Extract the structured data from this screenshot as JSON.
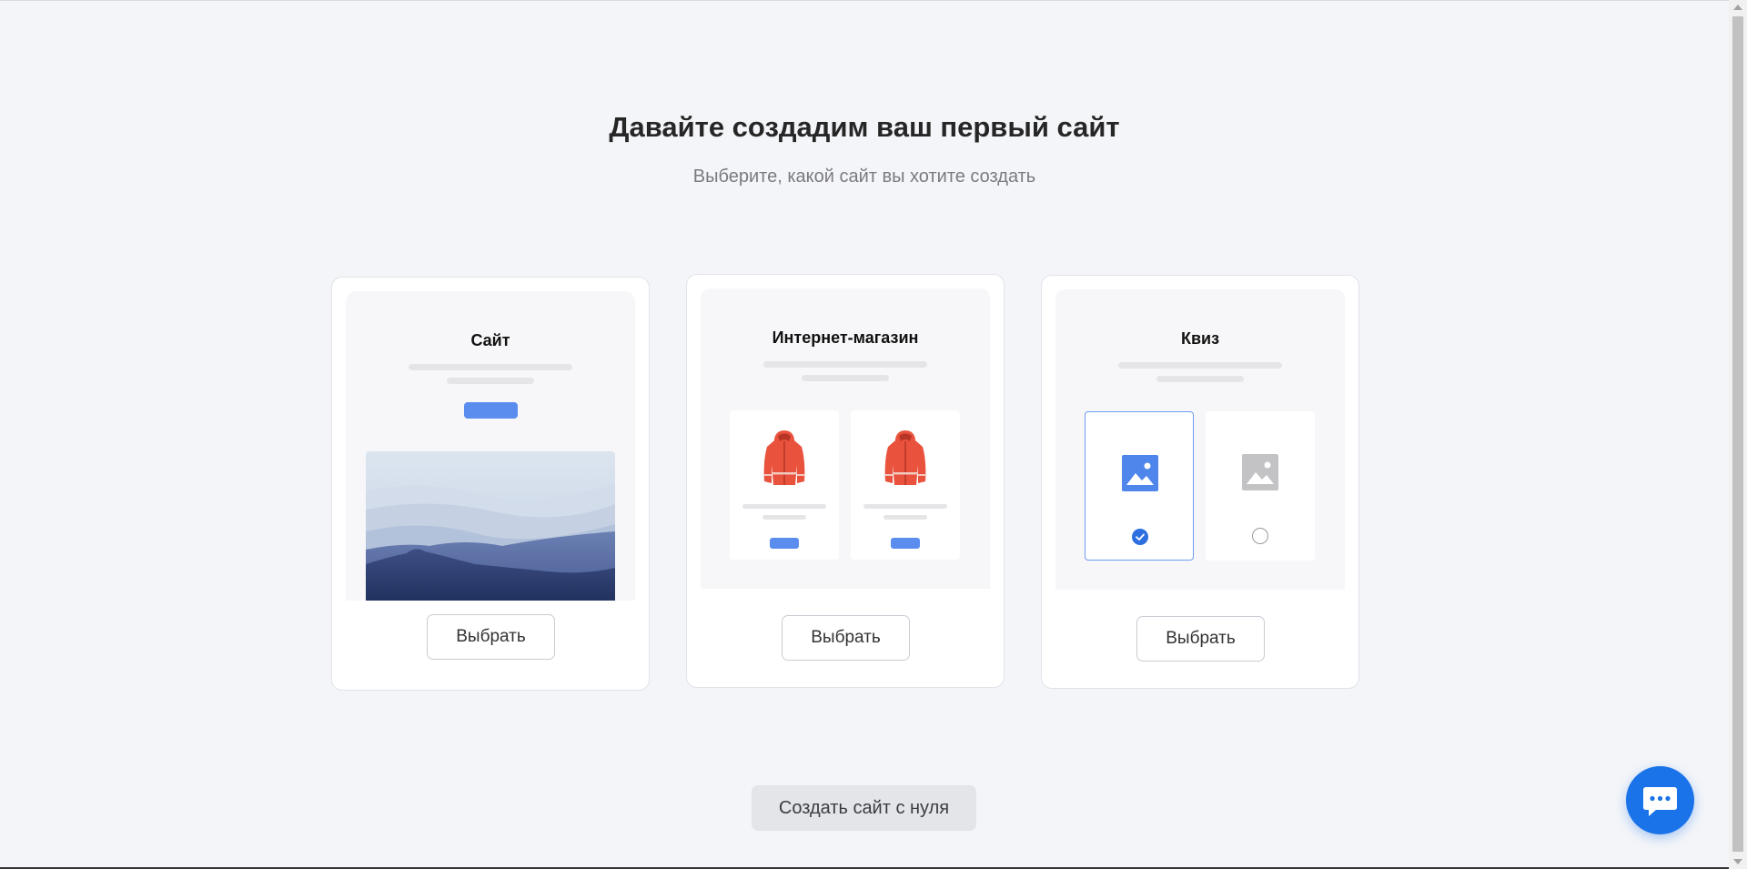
{
  "header": {
    "title": "Давайте создадим ваш первый сайт",
    "subtitle": "Выберите, какой сайт вы хотите создать"
  },
  "cards": [
    {
      "title": "Сайт",
      "button_label": "Выбрать"
    },
    {
      "title": "Интернет-магазин",
      "button_label": "Выбрать"
    },
    {
      "title": "Квиз",
      "button_label": "Выбрать"
    }
  ],
  "footer": {
    "scratch_label": "Создать сайт с нуля"
  },
  "colors": {
    "accent": "#5b8def",
    "chat_button": "#1a73e8",
    "background": "#f4f5f9"
  },
  "icons": {
    "chat": "chat-bubble-icon",
    "jacket": "jacket-icon",
    "image": "image-icon",
    "check": "check-icon"
  }
}
